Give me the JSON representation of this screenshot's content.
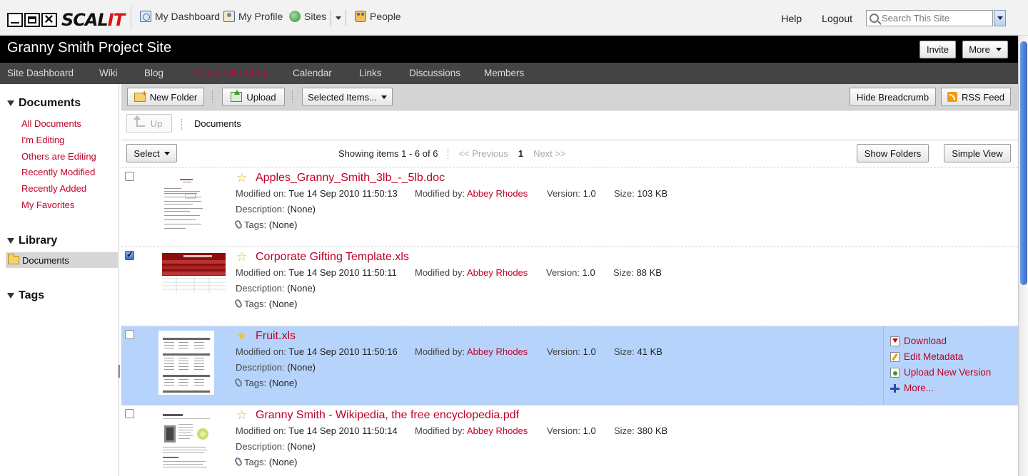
{
  "logo": {
    "brand_black": "SCAL",
    "brand_red": "IT"
  },
  "topnav": {
    "dashboard": "My Dashboard",
    "profile": "My Profile",
    "sites": "Sites",
    "people": "People",
    "help": "Help",
    "logout": "Logout",
    "search_placeholder": "Search This Site"
  },
  "site": {
    "title": "Granny Smith Project Site",
    "invite": "Invite",
    "more": "More"
  },
  "sitenav": [
    "Site Dashboard",
    "Wiki",
    "Blog",
    "Document Library",
    "Calendar",
    "Links",
    "Discussions",
    "Members"
  ],
  "sitenav_active": "Document Library",
  "sidebar": {
    "documents_head": "Documents",
    "filters": [
      "All Documents",
      "I'm Editing",
      "Others are Editing",
      "Recently Modified",
      "Recently Added",
      "My Favorites"
    ],
    "library_head": "Library",
    "library_folder": "Documents",
    "tags_head": "Tags"
  },
  "toolbar": {
    "new_folder": "New Folder",
    "upload": "Upload",
    "selected_items": "Selected Items...",
    "hide_breadcrumb": "Hide Breadcrumb",
    "rss_feed": "RSS Feed"
  },
  "breadcrumb": {
    "up": "Up",
    "current": "Documents"
  },
  "listhead": {
    "select": "Select",
    "showing": "Showing items 1 - 6 of 6",
    "previous": "<< Previous",
    "page": "1",
    "next": "Next >>",
    "show_folders": "Show Folders",
    "simple_view": "Simple View"
  },
  "labels": {
    "modified_on": "Modified on:",
    "modified_by": "Modified by:",
    "version": "Version:",
    "size": "Size:",
    "description": "Description:",
    "tags": "Tags:"
  },
  "documents": [
    {
      "name": "Apples_Granny_Smith_3lb_-_5lb.doc",
      "modified_on": "Tue 14 Sep 2010 11:50:13",
      "modified_by": "Abbey Rhodes",
      "version": "1.0",
      "size": "103 KB",
      "description": "(None)",
      "tags": "(None)",
      "checked": false
    },
    {
      "name": "Corporate Gifting Template.xls",
      "modified_on": "Tue 14 Sep 2010 11:50:11",
      "modified_by": "Abbey Rhodes",
      "version": "1.0",
      "size": "88 KB",
      "description": "(None)",
      "tags": "(None)",
      "checked": true
    },
    {
      "name": "Fruit.xls",
      "modified_on": "Tue 14 Sep 2010 11:50:16",
      "modified_by": "Abbey Rhodes",
      "version": "1.0",
      "size": "41 KB",
      "description": "(None)",
      "tags": "(None)",
      "checked": false
    },
    {
      "name": "Granny Smith - Wikipedia, the free encyclopedia.pdf",
      "modified_on": "Tue 14 Sep 2010 11:50:14",
      "modified_by": "Abbey Rhodes",
      "version": "1.0",
      "size": "380 KB",
      "description": "(None)",
      "tags": "(None)",
      "checked": false
    }
  ],
  "row_actions": {
    "download": "Download",
    "edit_metadata": "Edit Metadata",
    "upload_new_version": "Upload New Version",
    "more": "More..."
  },
  "colors": {
    "accent_red": "#c00028",
    "selected_row": "#b6d4fb",
    "titlebar": "#000000",
    "navbar": "#444444"
  }
}
